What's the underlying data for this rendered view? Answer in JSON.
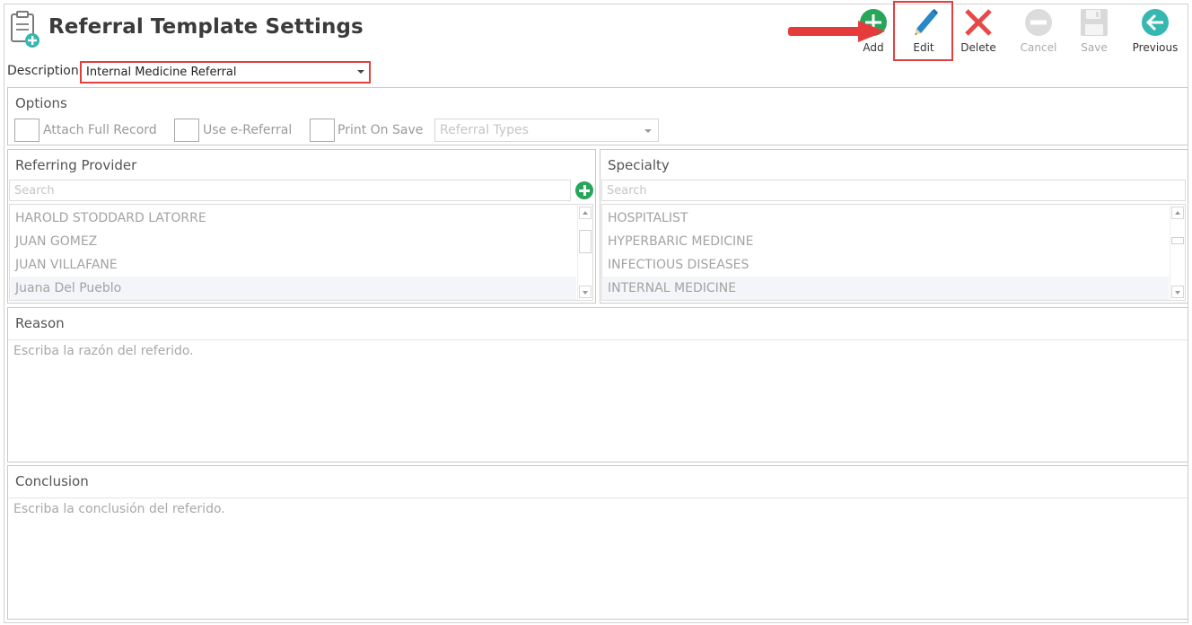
{
  "header": {
    "title": "Referral Template Settings",
    "icon": "clipboard-add-icon"
  },
  "toolbar": {
    "add_label": "Add",
    "edit_label": "Edit",
    "delete_label": "Delete",
    "cancel_label": "Cancel",
    "save_label": "Save",
    "previous_label": "Previous",
    "colors": {
      "add": "#27a55a",
      "edit": "#2a88c8",
      "delete": "#e84848",
      "disabled": "#d9d9d9",
      "previous": "#35b8b0",
      "highlight": "#e04040"
    }
  },
  "description": {
    "label": "Description:",
    "value": "Internal Medicine Referral"
  },
  "options": {
    "title": "Options",
    "attach_full_record": "Attach Full Record",
    "use_e_referral": "Use e-Referral",
    "print_on_save": "Print On Save",
    "referral_types_placeholder": "Referral Types"
  },
  "referring_provider": {
    "title": "Referring Provider",
    "search_placeholder": "Search",
    "items": [
      {
        "label": "HAROLD STODDARD LATORRE"
      },
      {
        "label": "JUAN GOMEZ"
      },
      {
        "label": "JUAN VILLAFANE"
      },
      {
        "label": "Juana  Del Pueblo"
      }
    ]
  },
  "specialty": {
    "title": "Specialty",
    "search_placeholder": "Search",
    "items": [
      {
        "label": "HOSPITALIST"
      },
      {
        "label": "HYPERBARIC MEDICINE"
      },
      {
        "label": "INFECTIOUS DISEASES"
      },
      {
        "label": "INTERNAL MEDICINE"
      }
    ]
  },
  "reason": {
    "title": "Reason",
    "placeholder": "Escriba la razón del referido."
  },
  "conclusion": {
    "title": "Conclusion",
    "placeholder": "Escriba la conclusión del referido."
  }
}
